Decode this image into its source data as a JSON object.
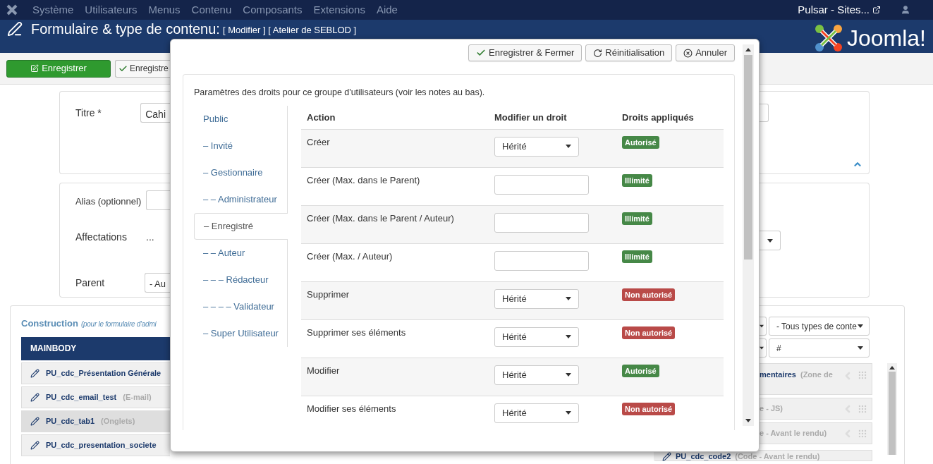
{
  "nav": {
    "menu": [
      "Système",
      "Utilisateurs",
      "Menus",
      "Contenu",
      "Composants",
      "Extensions",
      "Aide"
    ],
    "site": "Pulsar - Sites..."
  },
  "header": {
    "title": "Formulaire & type de contenu:",
    "subtitle": "[ Modifier ] [ Atelier de SEBLOD ]",
    "logo": "Joomla!"
  },
  "toolbar": {
    "buttons": [
      {
        "label": "Enregistrer",
        "kind": "primary"
      },
      {
        "label": "Enregistre",
        "kind": "default"
      }
    ]
  },
  "form": {
    "title_label": "Titre *",
    "title_value": "Cahi",
    "alias_label": "Alias (optionnel)",
    "assignments_label": "Affectations",
    "assignments_value": "...",
    "parent_label": "Parent",
    "parent_value": "- Au"
  },
  "construction": {
    "title": "Construction",
    "subtitle": "(pour le formulaire d'admi",
    "section": "MAINBODY",
    "fields": [
      {
        "name": "PU_cdc_Présentation Générale",
        "selected": false
      },
      {
        "name": "PU_cdc_email_test",
        "type": "(E-mail)",
        "selected": false
      },
      {
        "name": "PU_cdc_tab1",
        "type": "(Onglets)",
        "selected": true
      },
      {
        "name": "PU_cdc_presentation_societe",
        "selected": false
      }
    ],
    "filters": [
      "- Tous types de conte",
      "#"
    ],
    "right_fields": [
      {
        "name": "mentaires",
        "type": "(Zone de"
      },
      {
        "type": "e - JS)"
      },
      {
        "type": "e - Avant le rendu)"
      },
      {
        "name": "PU_cdc_code2",
        "type": "(Code - Avant le rendu)"
      }
    ]
  },
  "modal": {
    "buttons": [
      {
        "label": "Enregistrer & Fermer",
        "kind": "check"
      },
      {
        "label": "Réinitialisation",
        "kind": "refresh"
      },
      {
        "label": "Annuler",
        "kind": "cancel"
      }
    ],
    "intro": "Paramètres des droits pour ce groupe d'utilisateurs (voir les notes au bas).",
    "groups": [
      {
        "label": "Public",
        "selected": false
      },
      {
        "label": "– Invité",
        "selected": false
      },
      {
        "label": "– Gestionnaire",
        "selected": false
      },
      {
        "label": "– – Administrateur",
        "selected": false
      },
      {
        "label": "– Enregistré",
        "selected": true
      },
      {
        "label": "– – Auteur",
        "selected": false
      },
      {
        "label": "– – – Rédacteur",
        "selected": false
      },
      {
        "label": "– – – – Validateur",
        "selected": false
      },
      {
        "label": "– Super Utilisateur",
        "selected": false
      }
    ],
    "columns": [
      "Action",
      "Modifier un droit",
      "Droits appliqués"
    ],
    "rows": [
      {
        "action": "Créer",
        "kind": "select",
        "value": "Hérité",
        "badge": "Autorisé",
        "color": "#468847"
      },
      {
        "action": "Créer (Max. dans le Parent)",
        "kind": "input",
        "value": "",
        "badge": "Illimité",
        "color": "#468847"
      },
      {
        "action": "Créer (Max. dans le Parent / Auteur)",
        "kind": "input",
        "value": "",
        "badge": "Illimité",
        "color": "#468847"
      },
      {
        "action": "Créer (Max. / Auteur)",
        "kind": "input",
        "value": "",
        "badge": "Illimité",
        "color": "#468847"
      },
      {
        "action": "Supprimer",
        "kind": "select",
        "value": "Hérité",
        "badge": "Non autorisé",
        "color": "#b94a48"
      },
      {
        "action": "Supprimer ses éléments",
        "kind": "select",
        "value": "Hérité",
        "badge": "Non autorisé",
        "color": "#b94a48"
      },
      {
        "action": "Modifier",
        "kind": "select",
        "value": "Hérité",
        "badge": "Autorisé",
        "color": "#468847"
      },
      {
        "action": "Modifier ses éléments",
        "kind": "select",
        "value": "Hérité",
        "badge": "Non autorisé",
        "color": "#b94a48"
      }
    ]
  }
}
